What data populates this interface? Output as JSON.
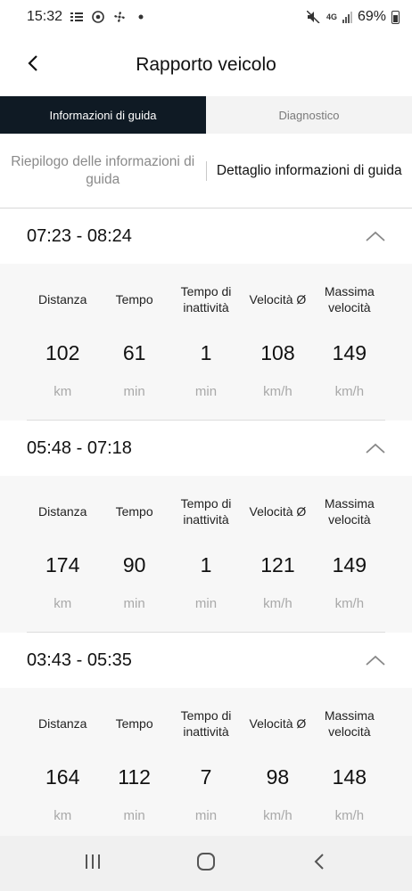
{
  "status_bar": {
    "time": "15:32",
    "network_type": "4G",
    "battery_percent": "69%",
    "icons": [
      "notification-icon",
      "chrome-icon",
      "fan-icon",
      "dot-icon",
      "mute-icon",
      "signal-icon",
      "battery-icon"
    ]
  },
  "header": {
    "title": "Rapporto veicolo",
    "back_icon": "chevron-left-icon"
  },
  "tabs": [
    {
      "label": "Informazioni di guida",
      "active": true
    },
    {
      "label": "Diagnostico",
      "active": false
    }
  ],
  "subtabs": {
    "left": "Riepilogo delle informazioni di guida",
    "right": "Dettaglio informazioni di guida",
    "selected": "right"
  },
  "columns": {
    "distance": "Distanza",
    "time": "Tempo",
    "idle": "Tempo di inattività",
    "avg_speed": "Velocità Ø",
    "max_speed": "Massima velocità"
  },
  "units": {
    "distance": "km",
    "time": "min",
    "idle": "min",
    "avg_speed": "km/h",
    "max_speed": "km/h"
  },
  "trips": [
    {
      "time_range": "07:23 - 08:24",
      "distance": "102",
      "time": "61",
      "idle": "1",
      "avg_speed": "108",
      "max_speed": "149"
    },
    {
      "time_range": "05:48 - 07:18",
      "distance": "174",
      "time": "90",
      "idle": "1",
      "avg_speed": "121",
      "max_speed": "149"
    },
    {
      "time_range": "03:43 - 05:35",
      "distance": "164",
      "time": "112",
      "idle": "7",
      "avg_speed": "98",
      "max_speed": "148"
    }
  ],
  "colors": {
    "active_tab_bg": "#0f1a24",
    "active_tab_text": "#ffffff",
    "inactive_tab_bg": "#f3f3f3",
    "card_bg": "#f7f7f7",
    "unit_text": "#a9a9a9"
  },
  "nav_bar": {
    "icons": [
      "recent-apps-icon",
      "home-icon",
      "back-icon"
    ]
  }
}
